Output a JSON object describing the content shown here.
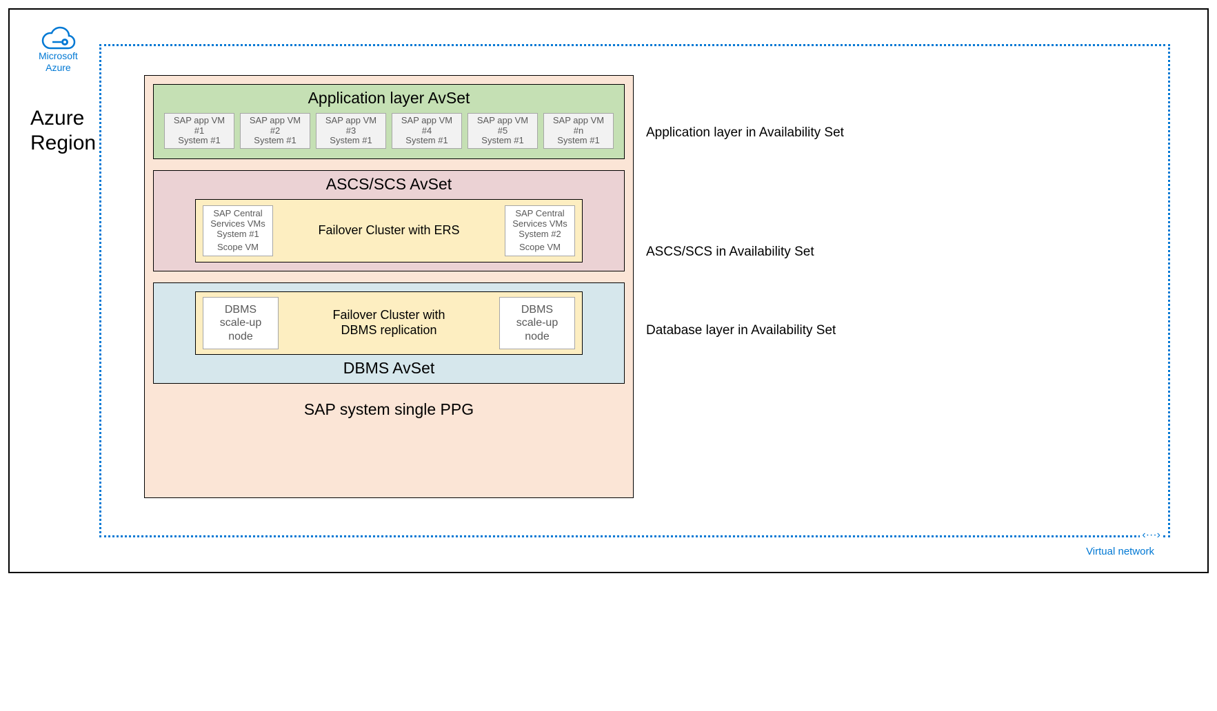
{
  "logo": {
    "line1": "Microsoft",
    "line2": "Azure"
  },
  "region_label": "Azure\nRegion",
  "vnet_label": "Virtual network",
  "ppg": {
    "title": "SAP system single PPG",
    "app_avset": {
      "title": "Application layer AvSet",
      "vms": [
        {
          "l1": "SAP app VM",
          "l2": "#1",
          "l3": "System #1"
        },
        {
          "l1": "SAP app VM",
          "l2": "#2",
          "l3": "System #1"
        },
        {
          "l1": "SAP app VM",
          "l2": "#3",
          "l3": "System #1"
        },
        {
          "l1": "SAP app VM",
          "l2": "#4",
          "l3": "System #1"
        },
        {
          "l1": "SAP app VM",
          "l2": "#5",
          "l3": "System #1"
        },
        {
          "l1": "SAP app VM",
          "l2": "#n",
          "l3": "System #1"
        }
      ],
      "side_label": "Application layer in Availability Set"
    },
    "scs_avset": {
      "title": "ASCS/SCS AvSet",
      "failover_label": "Failover Cluster with ERS",
      "vm_left": {
        "l1": "SAP Central",
        "l2": "Services VMs",
        "l3": "System #1",
        "l4": "Scope VM"
      },
      "vm_right": {
        "l1": "SAP Central",
        "l2": "Services VMs",
        "l3": "System #2",
        "l4": "Scope VM"
      },
      "side_label": "ASCS/SCS in Availability Set"
    },
    "db_avset": {
      "title": "DBMS AvSet",
      "failover_label_l1": "Failover Cluster with",
      "failover_label_l2": "DBMS replication",
      "vm_left": {
        "l1": "DBMS",
        "l2": "scale-up",
        "l3": "node"
      },
      "vm_right": {
        "l1": "DBMS",
        "l2": "scale-up",
        "l3": "node"
      },
      "side_label": "Database layer in Availability Set"
    }
  }
}
